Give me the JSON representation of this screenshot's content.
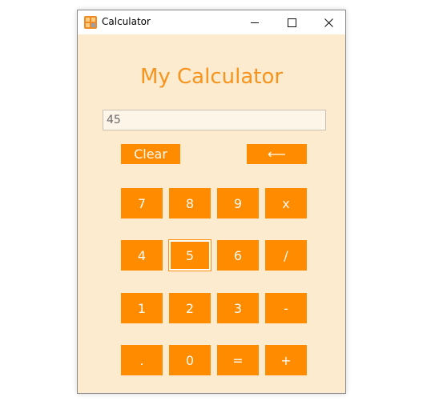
{
  "window": {
    "title": "Calculator",
    "controls": {
      "minimize": "minimize-icon",
      "maximize": "maximize-icon",
      "close": "close-icon"
    }
  },
  "app": {
    "heading": "My Calculator",
    "display_value": "45",
    "clear_label": "Clear",
    "backspace_label": "⟵",
    "keys": {
      "row1": [
        "7",
        "8",
        "9",
        "x"
      ],
      "row2": [
        "4",
        "5",
        "6",
        "/"
      ],
      "row3": [
        "1",
        "2",
        "3",
        "-"
      ],
      "row4": [
        ".",
        "0",
        "=",
        "+"
      ]
    }
  },
  "colors": {
    "accent": "#ff8c00",
    "background": "#fdebd0",
    "heading": "#f7941d"
  }
}
